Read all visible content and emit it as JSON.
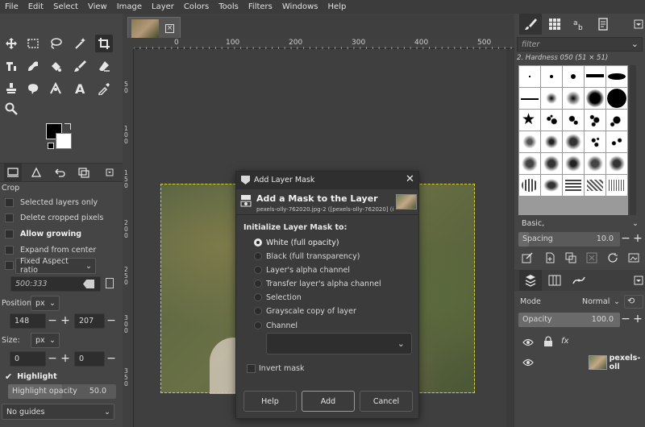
{
  "menubar": {
    "items": [
      "File",
      "Edit",
      "Select",
      "View",
      "Image",
      "Layer",
      "Colors",
      "Tools",
      "Filters",
      "Windows",
      "Help"
    ]
  },
  "toolbox": {
    "tool_options": {
      "title": "Crop",
      "selected_layers_only": "Selected layers only",
      "delete_cropped_pixels": "Delete cropped pixels",
      "allow_growing": "Allow growing",
      "expand_from_center": "Expand from center",
      "fixed_aspect": "Fixed Aspect ratio",
      "aspect_value": "500:333",
      "position_label": "Position:",
      "position_unit": "px",
      "pos_x": "148",
      "pos_y": "207",
      "size_label": "Size:",
      "size_unit": "px",
      "size_w": "0",
      "size_h": "0",
      "highlight": "Highlight",
      "highlight_opacity_label": "Highlight opacity",
      "highlight_opacity_value": "50.0",
      "guides": "No guides"
    }
  },
  "canvas": {
    "hruler_ticks": [
      "0",
      "100",
      "200",
      "300",
      "400",
      "500"
    ],
    "vruler_ticks": [
      "0",
      "5",
      "0",
      "1",
      "0",
      "0",
      "1",
      "5",
      "0",
      "2",
      "0",
      "0",
      "2",
      "5",
      "0",
      "3",
      "0",
      "0",
      "3",
      "5",
      "0"
    ]
  },
  "dialog": {
    "title": "Add Layer Mask",
    "heading": "Add a Mask to the Layer",
    "subtitle": "pexels-olly-762020.jpg-2 ([pexels-olly-762020] (i...",
    "section": "Initialize Layer Mask to:",
    "options": [
      "White (full opacity)",
      "Black (full transparency)",
      "Layer's alpha channel",
      "Transfer layer's alpha channel",
      "Selection",
      "Grayscale copy of layer",
      "Channel"
    ],
    "invert_mask": "Invert mask",
    "btn_help": "Help",
    "btn_add": "Add",
    "btn_cancel": "Cancel"
  },
  "right_panel": {
    "filter_placeholder": "filter",
    "brush_name": "2. Hardness 050 (51 × 51)",
    "brush_set": "Basic,",
    "spacing_label": "Spacing",
    "spacing_value": "10.0",
    "mode_label": "Mode",
    "mode_value": "Normal",
    "opacity_label": "Opacity",
    "opacity_value": "100.0",
    "layer_name": "pexels-oll"
  }
}
